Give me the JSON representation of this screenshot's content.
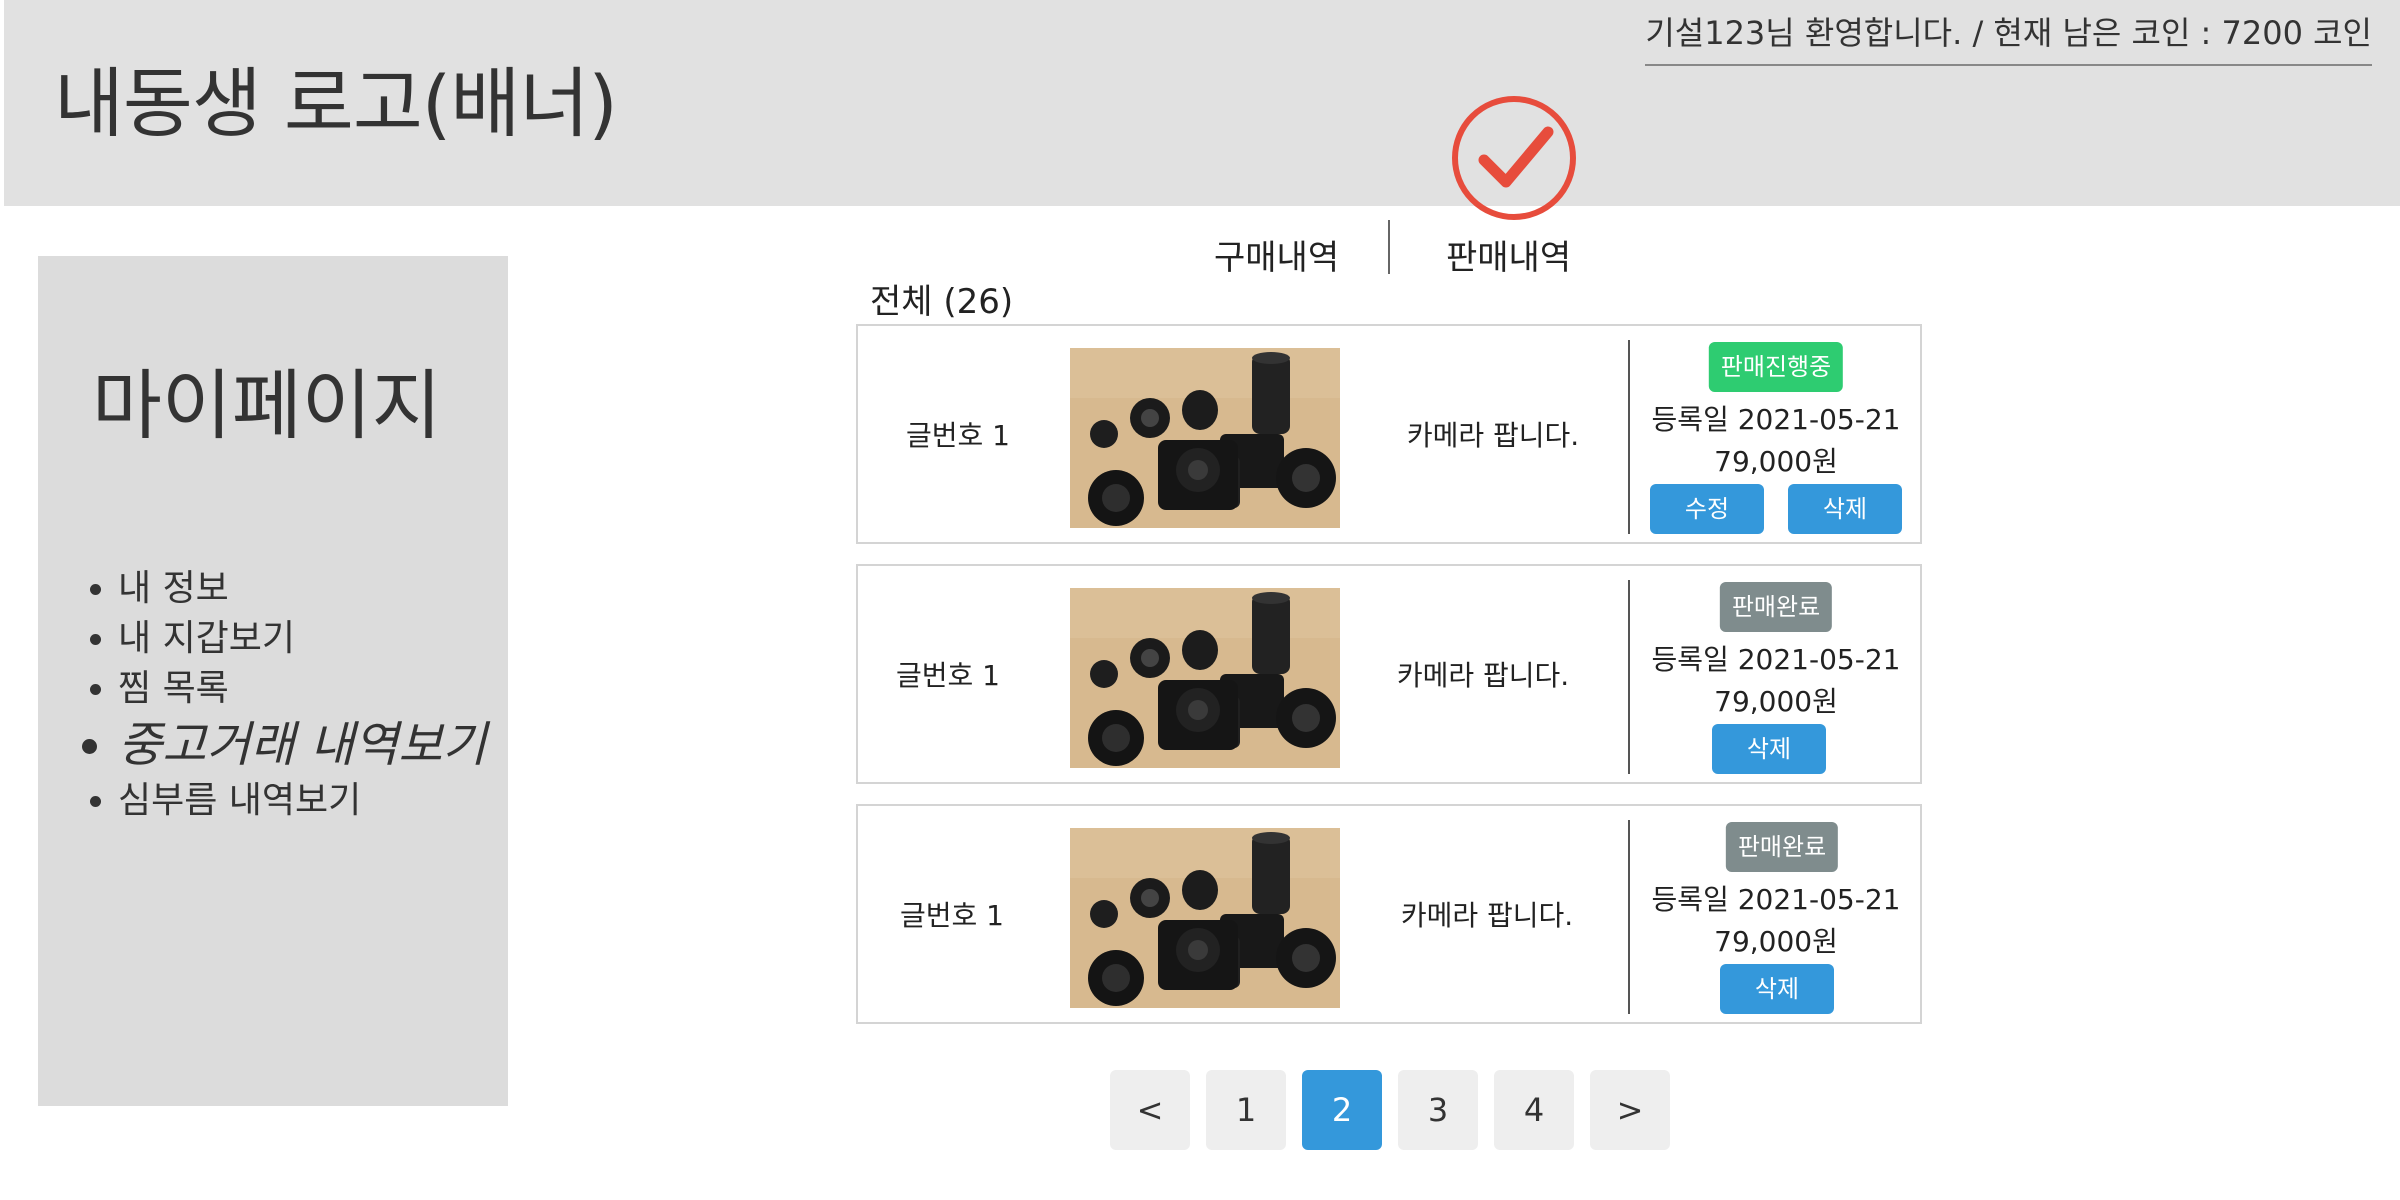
{
  "header": {
    "logo_text": "내동생 로고(배너)",
    "welcome_text": "기설123님 환영합니다.  / 현재 남은 코인 : 7200 코인"
  },
  "sidebar": {
    "title": "마이페이지",
    "items": [
      {
        "label": "내 정보"
      },
      {
        "label": "내 지갑보기"
      },
      {
        "label": "찜 목록"
      },
      {
        "label": "중고거래 내역보기",
        "active": true
      },
      {
        "label": "심부름 내역보기"
      }
    ]
  },
  "tabs": {
    "buy": "구매내역",
    "sell": "판매내역"
  },
  "list": {
    "total_label": "전체 (26)",
    "items": [
      {
        "post_no": "글번호 1",
        "title": "카메라 팝니다.",
        "status": "판매진행중",
        "status_color": "#2ecc71",
        "date": "등록일 2021-05-21",
        "price": "79,000원",
        "edit_label": "수정",
        "delete_label": "삭제"
      },
      {
        "post_no": "글번호 1",
        "title": "카메라 팝니다.",
        "status": "판매완료",
        "status_color": "#7f8c8d",
        "date": "등록일 2021-05-21",
        "price": "79,000원",
        "delete_label": "삭제"
      },
      {
        "post_no": "글번호 1",
        "title": "카메라 팝니다.",
        "status": "판매완료",
        "status_color": "#7f8c8d",
        "date": "등록일 2021-05-21",
        "price": "79,000원",
        "delete_label": "삭제"
      }
    ]
  },
  "pagination": {
    "prev": "<",
    "next": ">",
    "pages": [
      "1",
      "2",
      "3",
      "4"
    ],
    "current": "2"
  },
  "colors": {
    "accent": "#3498db",
    "header_bg": "#e1e1e1",
    "sidebar_bg": "#dcdcdc",
    "check_mark": "#e74c3c"
  }
}
